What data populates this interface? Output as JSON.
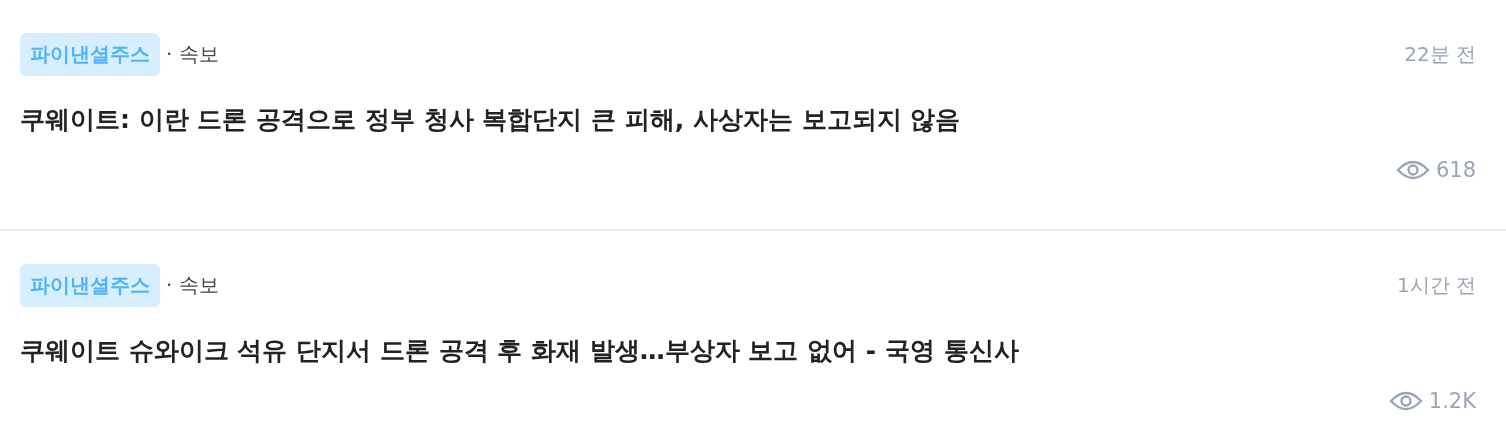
{
  "news_items": [
    {
      "source": "파이낸셜주스",
      "category": "· 속보",
      "time": "22분 전",
      "headline": "쿠웨이트: 이란 드론 공격으로 정부 청사 복합단지 큰 피해, 사상자는 보고되지 않음",
      "views": "618"
    },
    {
      "source": "파이낸셜주스",
      "category": "· 속보",
      "time": "1시간 전",
      "headline": "쿠웨이트 슈와이크 석유 단지서 드론 공격 후 화재 발생…부상자 보고 없어 - 국영 통신사",
      "views": "1.2K"
    }
  ]
}
